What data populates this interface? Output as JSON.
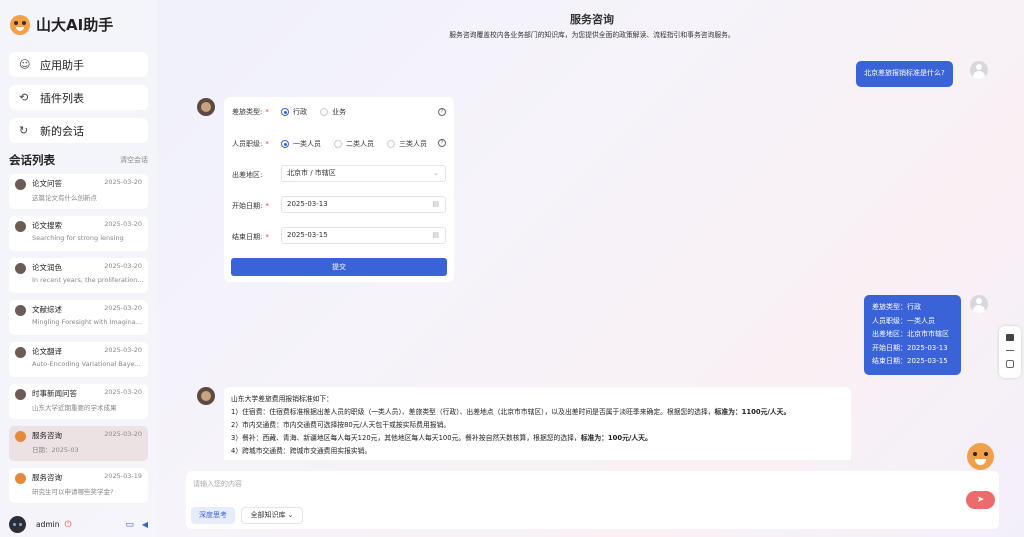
{
  "app": {
    "title": "山大AI助手"
  },
  "sidebar": {
    "nav": [
      {
        "icon": "smile-icon",
        "glyph": "☺",
        "label": "应用助手"
      },
      {
        "icon": "plugin-icon",
        "glyph": "⟲",
        "label": "插件列表"
      },
      {
        "icon": "refresh-icon",
        "glyph": "↻",
        "label": "新的会话"
      }
    ],
    "sessions_title": "会话列表",
    "clear_label": "清空会话",
    "sessions": [
      {
        "name": "论文问答",
        "date": "2025-03-20",
        "sub": "这篇论文有什么创新点"
      },
      {
        "name": "论文搜索",
        "date": "2025-03-20",
        "sub": "Searching for strong lensing"
      },
      {
        "name": "论文润色",
        "date": "2025-03-20",
        "sub": "In recent years, the proliferation ..."
      },
      {
        "name": "文献综述",
        "date": "2025-03-20",
        "sub": "Mingling Foresight with Imaginat..."
      },
      {
        "name": "论文翻译",
        "date": "2025-03-20",
        "sub": "Auto-Encoding Variational Baye..."
      },
      {
        "name": "时事新闻问答",
        "date": "2025-03-20",
        "sub": "山东大学近期重要的学术成果"
      },
      {
        "name": "服务咨询",
        "date": "2025-03-20",
        "sub": "日期：2025-03",
        "active": true
      },
      {
        "name": "服务咨询",
        "date": "2025-03-19",
        "sub": "研究生可以申请哪些奖学金?"
      }
    ],
    "user": {
      "name": "admin"
    }
  },
  "header": {
    "title": "服务咨询",
    "subtitle": "服务咨询覆盖校内各业务部门的知识库，为您提供全面的政策解读、流程指引和事务咨询服务。"
  },
  "chat": {
    "q1": "北京差旅报销标准是什么?",
    "form": {
      "trip_type_label": "差旅类型:",
      "trip_options": [
        "行政",
        "业务"
      ],
      "level_label": "人员职级:",
      "level_options": [
        "一类人员",
        "二类人员",
        "三类人员"
      ],
      "region_label": "出差地区:",
      "region_value": "北京市 / 市辖区",
      "start_label": "开始日期:",
      "start_value": "2025-03-13",
      "end_label": "结束日期:",
      "end_value": "2025-03-15",
      "required_mark": "*",
      "help_glyph": "?",
      "submit_label": "提交"
    },
    "q2_lines": [
      "差旅类型：行政",
      "人员职级：一类人员",
      "出差地区：北京市市辖区",
      "开始日期：2025-03-13",
      "结束日期：2025-03-15"
    ],
    "answer": {
      "intro": "山东大学差旅费用报销标准如下：",
      "l1": "1）住宿费：住宿费标准根据出差人员的职级（一类人员）、差旅类型（行政）、出差地点（北京市市辖区），以及出差时间是否属于淡旺季来确定。根据您的选择，",
      "l1_bold": "标准为：1100元/人天。",
      "l2": "2）市内交通费：市内交通费可选择按80元/人天包干或按实际费用报销。",
      "l3": "3）餐补：西藏、青海、新疆地区每人每天120元，其他地区每人每天100元。餐补按自然天数核算，根据您的选择，",
      "l3_bold": "标准为：100元/人天。",
      "l4": "4）跨城市交通费：跨城市交通费用实报实销。"
    }
  },
  "input": {
    "placeholder": "请输入您的内容",
    "chip_deep": "深度思考",
    "chip_kb": "全部知识库 ⌄"
  },
  "colors": {
    "accent": "#3a63d8",
    "send": "#ee6b6b"
  }
}
